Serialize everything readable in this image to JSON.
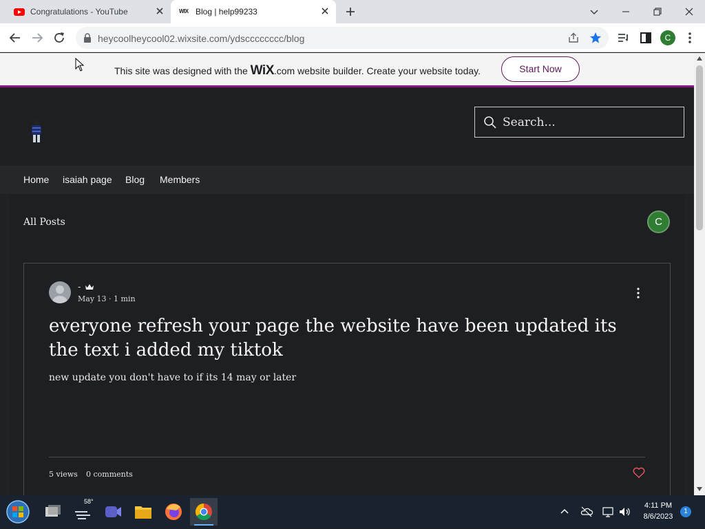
{
  "browser": {
    "tabs": [
      {
        "title": "Congratulations - YouTube",
        "favicon": "youtube-icon"
      },
      {
        "title": "Blog | help99233",
        "favicon": "wix-icon",
        "favicon_text": "WIX"
      }
    ],
    "url": "heycoolheycool02.wixsite.com/ydscccccccc/blog",
    "profile_initial": "C"
  },
  "wix_banner": {
    "text_before": "This site was designed with the ",
    "logo": "WiX",
    "text_after": ".com website builder. Create your website today.",
    "button": "Start Now"
  },
  "site": {
    "search_placeholder": "Search...",
    "nav": [
      "Home",
      "isaiah page",
      "Blog",
      "Members"
    ]
  },
  "blog": {
    "section_title": "All Posts",
    "member_initial": "C",
    "post": {
      "author": "-",
      "date": "May 13",
      "read_time": "1 min",
      "title": "everyone refresh your page the website have been updated its the text i added my tiktok",
      "excerpt": "new update you don't have to if its 14 may or later",
      "views": "5 views",
      "comments": "0 comments"
    }
  },
  "taskbar": {
    "weather": "58°",
    "time": "4:11 PM",
    "date": "8/6/2023",
    "notifications": "1"
  },
  "colors": {
    "wix_purple": "#8a1b86",
    "site_bg": "#1e1f22",
    "avatar_green": "#2e7d32",
    "heart_red": "#e05555"
  }
}
